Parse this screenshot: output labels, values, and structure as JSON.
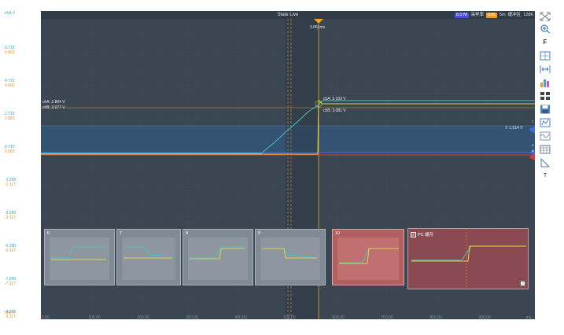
{
  "titlebar": {
    "title": "State Live",
    "sample_rate": "8.0 M",
    "storage_label": "采样率",
    "storage_value": "20K",
    "timebase": "5m",
    "buffer_label": "缓冲区",
    "buffer_count": "128K"
  },
  "axes": {
    "y_top_label": "chA V",
    "y_bottom_label": "chB V",
    "y_ticks": [
      {
        "a": "6.710",
        "b": "6.883"
      },
      {
        "a": "4.710",
        "b": "4.883"
      },
      {
        "a": "2.710",
        "b": "2.883"
      },
      {
        "a": "0.710",
        "b": "0.883"
      },
      {
        "a": "-1.290",
        "b": "-1.117"
      },
      {
        "a": "-3.290",
        "b": "-3.117"
      },
      {
        "a": "-5.290",
        "b": "-5.117"
      },
      {
        "a": "-7.290",
        "b": "-7.117"
      },
      {
        "a": "-9.290",
        "b": "-9.117"
      }
    ],
    "x_ticks": [
      "0.00",
      "100.00",
      "200.00",
      "300.00",
      "400.00",
      "500.00",
      "600.00",
      "700.00",
      "800.00",
      "900.00"
    ],
    "x_unit": "ms"
  },
  "measurements": {
    "cursor_time": "3.061ms",
    "cha_left": "chA: 2.804 V",
    "chb_left": "chB: 3.077 V",
    "cha_right": "chA: 3.103 V",
    "chb_right": "chB: 3.081 V",
    "trigger": "T: 1.514 V"
  },
  "markers": {
    "trigger_marker": "T",
    "cha_marker": "A",
    "chb_marker": "B"
  },
  "history": {
    "frames": [
      {
        "label": "6"
      },
      {
        "label": "7"
      },
      {
        "label": "8"
      },
      {
        "label": "9"
      },
      {
        "label": "10"
      }
    ],
    "pc_cache_label": "PC 缓存"
  },
  "toolbar": {
    "items": [
      {
        "name": "fullscreen-icon"
      },
      {
        "name": "zoom-in-icon"
      },
      {
        "name": "fit-label",
        "label": "F"
      },
      {
        "name": "grid-fit-icon"
      },
      {
        "name": "horizontal-stretch-icon"
      },
      {
        "name": "histogram-icon"
      },
      {
        "name": "layout-grid-icon"
      },
      {
        "name": "save-icon"
      },
      {
        "name": "measure-icon"
      },
      {
        "name": "waveform-icon"
      },
      {
        "name": "table-icon"
      },
      {
        "name": "angle-ruler-icon"
      },
      {
        "name": "t-label",
        "label": "T"
      }
    ]
  },
  "colors": {
    "cha": "#3fc4c8",
    "chb": "#e0d048",
    "background": "#3a4652",
    "cursor": "#e8952e",
    "trigger_band": "#2f5c8a"
  }
}
